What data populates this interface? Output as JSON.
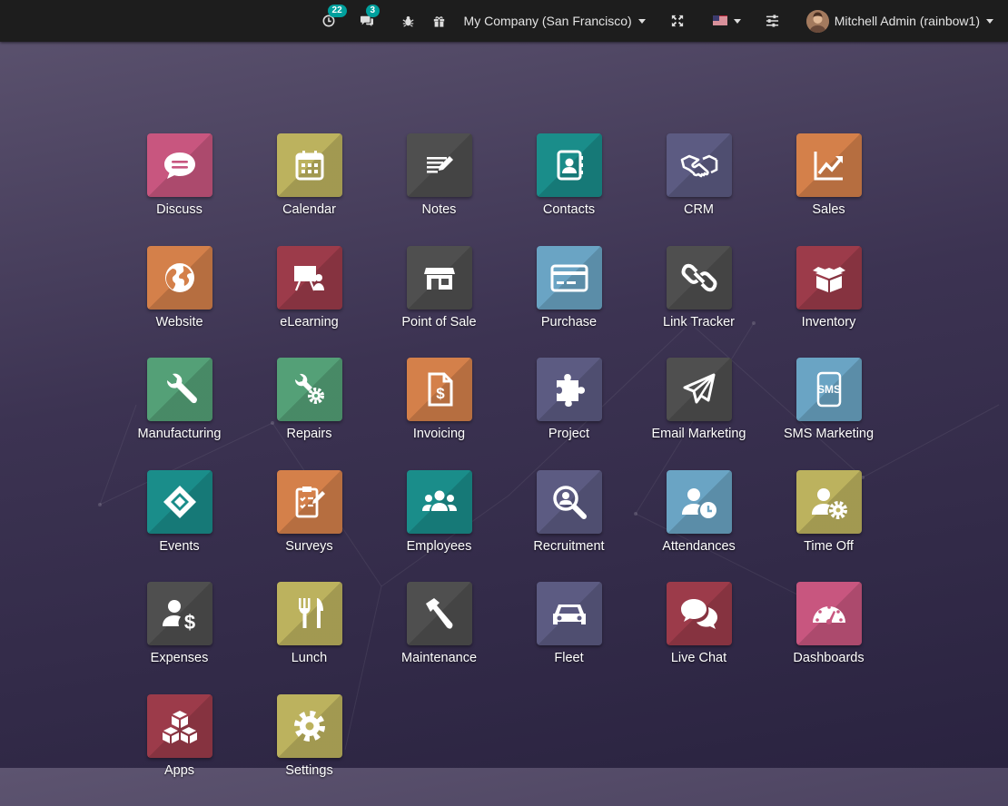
{
  "topbar": {
    "activity_count": "22",
    "message_count": "3",
    "company": "My Company (San Francisco)",
    "user": "Mitchell Admin (rainbow1)"
  },
  "apps": [
    {
      "label": "Discuss",
      "color": "#c8567f",
      "icon": "chat-bubble-icon"
    },
    {
      "label": "Calendar",
      "color": "#bcb25e",
      "icon": "calendar-icon"
    },
    {
      "label": "Notes",
      "color": "#4f4f4f",
      "icon": "notes-icon"
    },
    {
      "label": "Contacts",
      "color": "#1a8d8a",
      "icon": "address-book-icon"
    },
    {
      "label": "CRM",
      "color": "#5c5b82",
      "icon": "handshake-icon"
    },
    {
      "label": "Sales",
      "color": "#d4804a",
      "icon": "trend-chart-icon"
    },
    {
      "label": "Website",
      "color": "#d4804a",
      "icon": "globe-icon"
    },
    {
      "label": "eLearning",
      "color": "#9c3b4a",
      "icon": "teacher-board-icon"
    },
    {
      "label": "Point of Sale",
      "color": "#4f4f4f",
      "icon": "shop-icon"
    },
    {
      "label": "Purchase",
      "color": "#6aa4c4",
      "icon": "credit-card-icon"
    },
    {
      "label": "Link Tracker",
      "color": "#4f4f4f",
      "icon": "link-icon"
    },
    {
      "label": "Inventory",
      "color": "#9c3b4a",
      "icon": "box-icon"
    },
    {
      "label": "Manufacturing",
      "color": "#54a077",
      "icon": "wrench-icon"
    },
    {
      "label": "Repairs",
      "color": "#54a077",
      "icon": "wrench-gear-icon"
    },
    {
      "label": "Invoicing",
      "color": "#d4804a",
      "icon": "invoice-dollar-icon"
    },
    {
      "label": "Project",
      "color": "#5c5b82",
      "icon": "puzzle-icon"
    },
    {
      "label": "Email Marketing",
      "color": "#4f4f4f",
      "icon": "paper-plane-icon"
    },
    {
      "label": "SMS Marketing",
      "color": "#6aa4c4",
      "icon": "sms-phone-icon"
    },
    {
      "label": "Events",
      "color": "#1a8d8a",
      "icon": "ticket-icon"
    },
    {
      "label": "Surveys",
      "color": "#d4804a",
      "icon": "survey-clipboard-icon"
    },
    {
      "label": "Employees",
      "color": "#1a8d8a",
      "icon": "people-group-icon"
    },
    {
      "label": "Recruitment",
      "color": "#5c5b82",
      "icon": "magnifier-icon"
    },
    {
      "label": "Attendances",
      "color": "#6aa4c4",
      "icon": "user-clock-icon"
    },
    {
      "label": "Time Off",
      "color": "#bcb25e",
      "icon": "user-gear-icon"
    },
    {
      "label": "Expenses",
      "color": "#4f4f4f",
      "icon": "user-dollar-icon"
    },
    {
      "label": "Lunch",
      "color": "#bcb25e",
      "icon": "cutlery-icon"
    },
    {
      "label": "Maintenance",
      "color": "#4f4f4f",
      "icon": "hammer-icon"
    },
    {
      "label": "Fleet",
      "color": "#5c5b82",
      "icon": "car-icon"
    },
    {
      "label": "Live Chat",
      "color": "#9c3b4a",
      "icon": "chat-bubbles-icon"
    },
    {
      "label": "Dashboards",
      "color": "#c8567f",
      "icon": "gauge-icon"
    },
    {
      "label": "Apps",
      "color": "#9c3b4a",
      "icon": "cubes-icon"
    },
    {
      "label": "Settings",
      "color": "#bcb25e",
      "icon": "gear-icon"
    }
  ]
}
